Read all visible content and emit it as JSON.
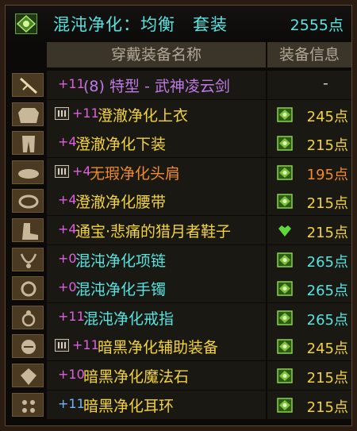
{
  "header": {
    "title": "混沌净化：均衡　套装",
    "points": "2555点"
  },
  "columns": {
    "name": "穿戴装备名称",
    "info": "装备信息"
  },
  "colors": {
    "cyan": "#55e4e0",
    "yellow": "#f2d33a",
    "orange": "#f08a2a",
    "magenta": "#e05ee0",
    "blue_level": "#6fb4ff"
  },
  "items": [
    {
      "slot_icon": "sword-icon",
      "badge": false,
      "level": "+11",
      "level_color": "#e05ee0",
      "name": "(8) 特型 - 武神凌云剑",
      "name_color": "#c07ae8",
      "info_icon": null,
      "points": "-",
      "points_color": "#d8d0c0"
    },
    {
      "slot_icon": "coat-icon",
      "badge": true,
      "level": "+11",
      "level_color": "#e05ee0",
      "name": "澄澈净化上衣",
      "name_color": "#f2d33a",
      "info_icon": "set-emblem-icon",
      "points": "245点",
      "points_color": "#f2d33a"
    },
    {
      "slot_icon": "pants-icon",
      "badge": false,
      "level": "+4",
      "level_color": "#e05ee0",
      "name": "澄澈净化下装",
      "name_color": "#f2d33a",
      "info_icon": "set-emblem-icon",
      "points": "215点",
      "points_color": "#f2d33a"
    },
    {
      "slot_icon": "shoulder-icon",
      "badge": true,
      "level": "+4",
      "level_color": "#e05ee0",
      "name": "无瑕净化头肩",
      "name_color": "#f08a2a",
      "info_icon": "set-emblem-icon",
      "points": "195点",
      "points_color": "#f08a2a"
    },
    {
      "slot_icon": "belt-icon",
      "badge": false,
      "level": "+4",
      "level_color": "#e05ee0",
      "name": "澄澈净化腰带",
      "name_color": "#f2d33a",
      "info_icon": "set-emblem-icon",
      "points": "215点",
      "points_color": "#f2d33a"
    },
    {
      "slot_icon": "boots-icon",
      "badge": false,
      "level": "+4",
      "level_color": "#e05ee0",
      "name": "通宝·悲痛的猎月者鞋子",
      "name_color": "#f2d33a",
      "info_icon": "green-gem-icon",
      "points": "215点",
      "points_color": "#f2d33a"
    },
    {
      "slot_icon": "necklace-icon",
      "badge": false,
      "level": "+0",
      "level_color": "#e05ee0",
      "name": "混沌净化项链",
      "name_color": "#55e4e0",
      "info_icon": "set-emblem-icon",
      "points": "265点",
      "points_color": "#55e4e0"
    },
    {
      "slot_icon": "bracelet-icon",
      "badge": false,
      "level": "+0",
      "level_color": "#e05ee0",
      "name": "混沌净化手镯",
      "name_color": "#55e4e0",
      "info_icon": "set-emblem-icon",
      "points": "265点",
      "points_color": "#55e4e0"
    },
    {
      "slot_icon": "ring-icon",
      "badge": false,
      "level": "+11",
      "level_color": "#e05ee0",
      "name": "混沌净化戒指",
      "name_color": "#55e4e0",
      "info_icon": "set-emblem-icon",
      "points": "265点",
      "points_color": "#55e4e0"
    },
    {
      "slot_icon": "support-icon",
      "badge": true,
      "level": "+11",
      "level_color": "#e05ee0",
      "name": "暗黑净化辅助装备",
      "name_color": "#f2d33a",
      "info_icon": "set-emblem-icon",
      "points": "245点",
      "points_color": "#f2d33a"
    },
    {
      "slot_icon": "magic-stone-icon",
      "badge": false,
      "level": "+10",
      "level_color": "#e05ee0",
      "name": "暗黑净化魔法石",
      "name_color": "#f2d33a",
      "info_icon": "set-emblem-icon",
      "points": "215点",
      "points_color": "#f2d33a"
    },
    {
      "slot_icon": "earring-icon",
      "badge": false,
      "level": "+11",
      "level_color": "#6fb4ff",
      "name": "暗黑净化耳环",
      "name_color": "#f2d33a",
      "info_icon": "set-emblem-icon",
      "points": "215点",
      "points_color": "#f2d33a"
    }
  ]
}
